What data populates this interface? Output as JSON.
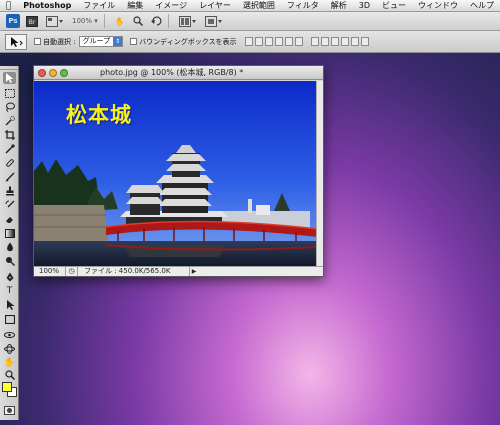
{
  "menubar": {
    "apple_icon": "apple-icon",
    "app_name": "Photoshop",
    "items": [
      "ファイル",
      "編集",
      "イメージ",
      "レイヤー",
      "選択範囲",
      "フィルタ",
      "解析",
      "3D",
      "ビュー",
      "ウィンドウ",
      "ヘルプ"
    ]
  },
  "appbar": {
    "logo": "Ps",
    "zoom_value": "100%"
  },
  "options": {
    "auto_select_label": "自動選択 :",
    "auto_select_value": "グループ",
    "bounding_box_label": "バウンディングボックスを表示"
  },
  "document": {
    "title": "photo.jpg @ 100% (松本城, RGB/8) *",
    "caption": "松本城",
    "status_zoom": "100%",
    "status_file": "ファイル : 450.0K/565.0K"
  },
  "swatches": {
    "foreground": "#ffff33",
    "background": "#ffffff"
  }
}
